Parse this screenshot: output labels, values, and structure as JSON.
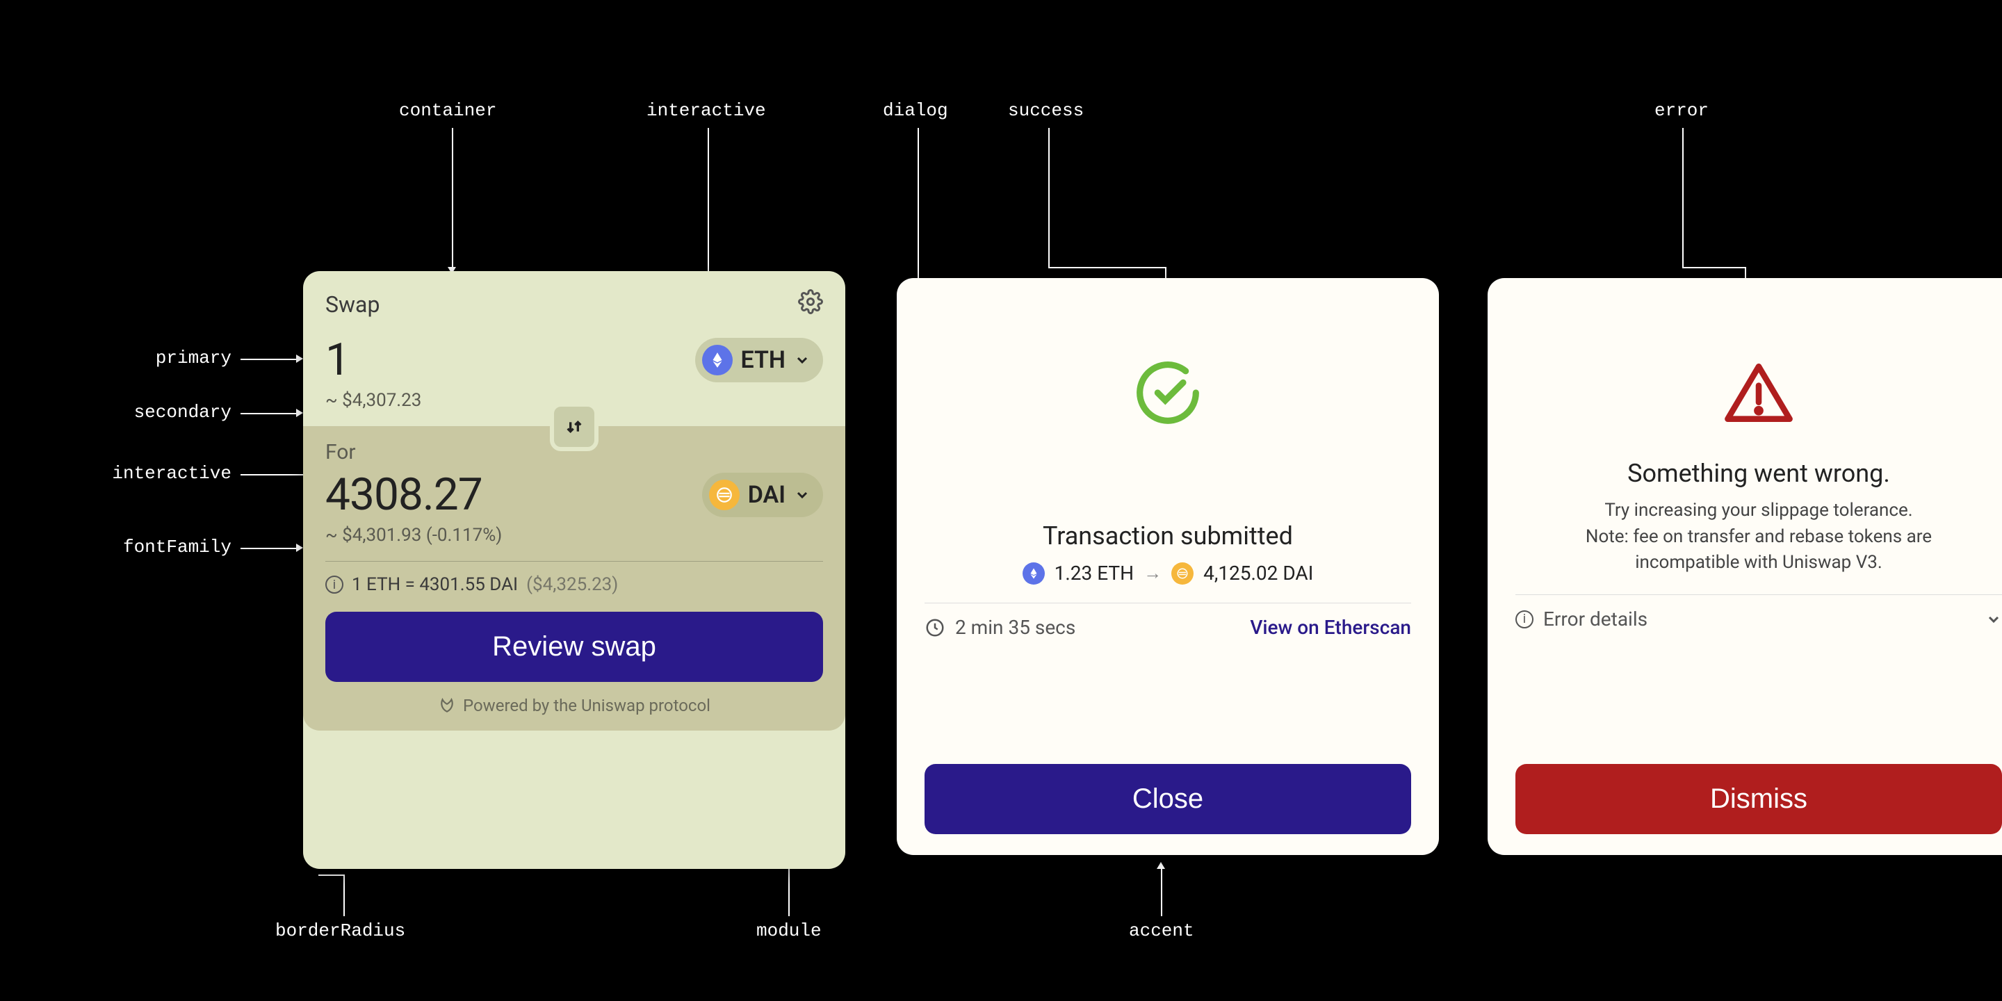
{
  "annotations": {
    "container": "container",
    "interactive": "interactive",
    "primary": "primary",
    "secondary": "secondary",
    "interactive2": "interactive",
    "fontFamily": "fontFamily",
    "borderRadius": "borderRadius",
    "module": "module",
    "dialog": "dialog",
    "success": "success",
    "accent": "accent",
    "error": "error"
  },
  "swap": {
    "title": "Swap",
    "input_amount": "1",
    "input_usd": "~ $4,307.23",
    "input_token": "ETH",
    "for_label": "For",
    "output_amount": "4308.27",
    "output_usd": "~ $4,301.93 (-0.117%)",
    "output_token": "DAI",
    "rate_text": "1 ETH = 4301.55 DAI",
    "rate_usd": "($4,325.23)",
    "cta": "Review swap",
    "powered": "Powered by the Uniswap protocol"
  },
  "success_dialog": {
    "title": "Transaction submitted",
    "from_amount": "1.23 ETH",
    "to_amount": "4,125.02 DAI",
    "time": "2 min 35 secs",
    "link": "View on Etherscan",
    "cta": "Close"
  },
  "error_dialog": {
    "title": "Something went wrong.",
    "body_line1": "Try increasing your slippage tolerance.",
    "body_line2": "Note: fee on transfer and rebase tokens are",
    "body_line3": "incompatible with Uniswap V3.",
    "details_label": "Error details",
    "cta": "Dismiss"
  }
}
